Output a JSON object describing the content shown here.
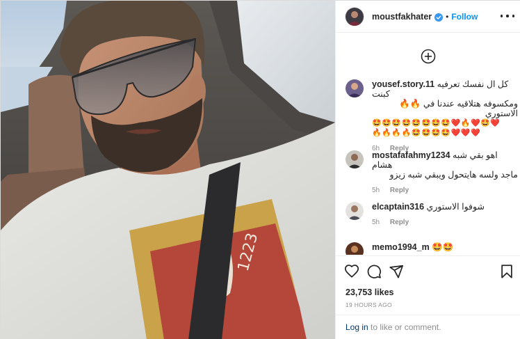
{
  "post": {
    "username": "moustfakhater",
    "verified": true,
    "separator": "•",
    "follow_label": "Follow",
    "more_icon": "more-options-icon"
  },
  "comments": [
    {
      "username": "yousef.story.11",
      "text_line1": "كل ال نفسك تعرفيه كبنت",
      "text_line2": "ومكسوفه هتلاقيه عندنا في الاستوري",
      "emoji_line1": "🔥🔥",
      "emoji_line2": "🤩🤩🤩🤩🤩🤩🤩🤩❤️🔥❤️🤩❤️",
      "emoji_line3": "🔥🔥🔥🔥🤩🤩🤩🤩❤️❤️❤️",
      "time": "6h",
      "reply_label": "Reply"
    },
    {
      "username": "mostafafahmy1234",
      "text_line1": "اهو بقي شبه هشام",
      "text_line2": "ماجد ولسه هايتحول ويبقي شبه زيزو",
      "time": "5h",
      "reply_label": "Reply"
    },
    {
      "username": "elcaptain316",
      "text_line1": "شوفوا الاستوري",
      "time": "5h",
      "reply_label": "Reply"
    },
    {
      "username": "memo1994_m",
      "text_line1": "🤩🤩"
    }
  ],
  "actions": {
    "like_icon": "heart-icon",
    "comment_icon": "comment-icon",
    "share_icon": "share-icon",
    "save_icon": "bookmark-icon"
  },
  "likes_text": "23,753 likes",
  "date_text": "19 HOURS AGO",
  "login": {
    "link_label": "Log in",
    "suffix": " to like or comment."
  },
  "colors": {
    "accent": "#0095f6",
    "text": "#262626",
    "muted": "#8e8e8e",
    "border": "#efefef",
    "link": "#00376b"
  }
}
